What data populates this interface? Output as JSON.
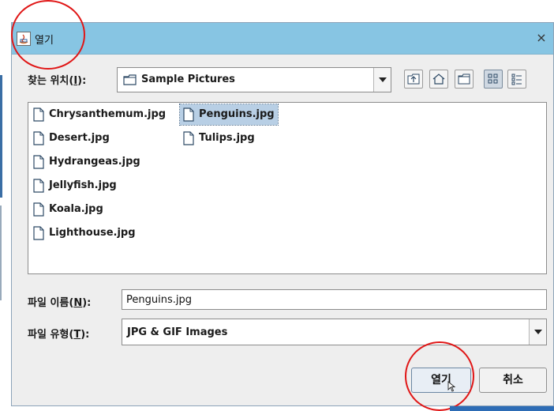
{
  "window": {
    "title": "열기",
    "close_glyph": "×"
  },
  "look_in": {
    "label_prefix": "찾는 위치(",
    "mnemonic": "I",
    "label_suffix": "):",
    "value": "Sample Pictures"
  },
  "toolbar": {
    "icons": [
      "up-folder-icon",
      "home-icon",
      "new-folder-icon",
      "list-view-icon",
      "details-view-icon"
    ]
  },
  "files": [
    {
      "name": "Chrysanthemum.jpg"
    },
    {
      "name": "Desert.jpg"
    },
    {
      "name": "Hydrangeas.jpg"
    },
    {
      "name": "Jellyfish.jpg"
    },
    {
      "name": "Koala.jpg"
    },
    {
      "name": "Lighthouse.jpg"
    },
    {
      "name": "Penguins.jpg",
      "selected": true
    },
    {
      "name": "Tulips.jpg"
    }
  ],
  "file_name": {
    "label_prefix": "파일 이름(",
    "mnemonic": "N",
    "label_suffix": "):",
    "value": "Penguins.jpg"
  },
  "file_type": {
    "label_prefix": "파일 유형(",
    "mnemonic": "T",
    "label_suffix": "):",
    "value": "JPG & GIF Images"
  },
  "buttons": {
    "open": "열기",
    "cancel": "취소"
  },
  "colors": {
    "titlebar": "#87c5e3",
    "selection": "#b8cfe5",
    "annotation": "#e01616"
  }
}
